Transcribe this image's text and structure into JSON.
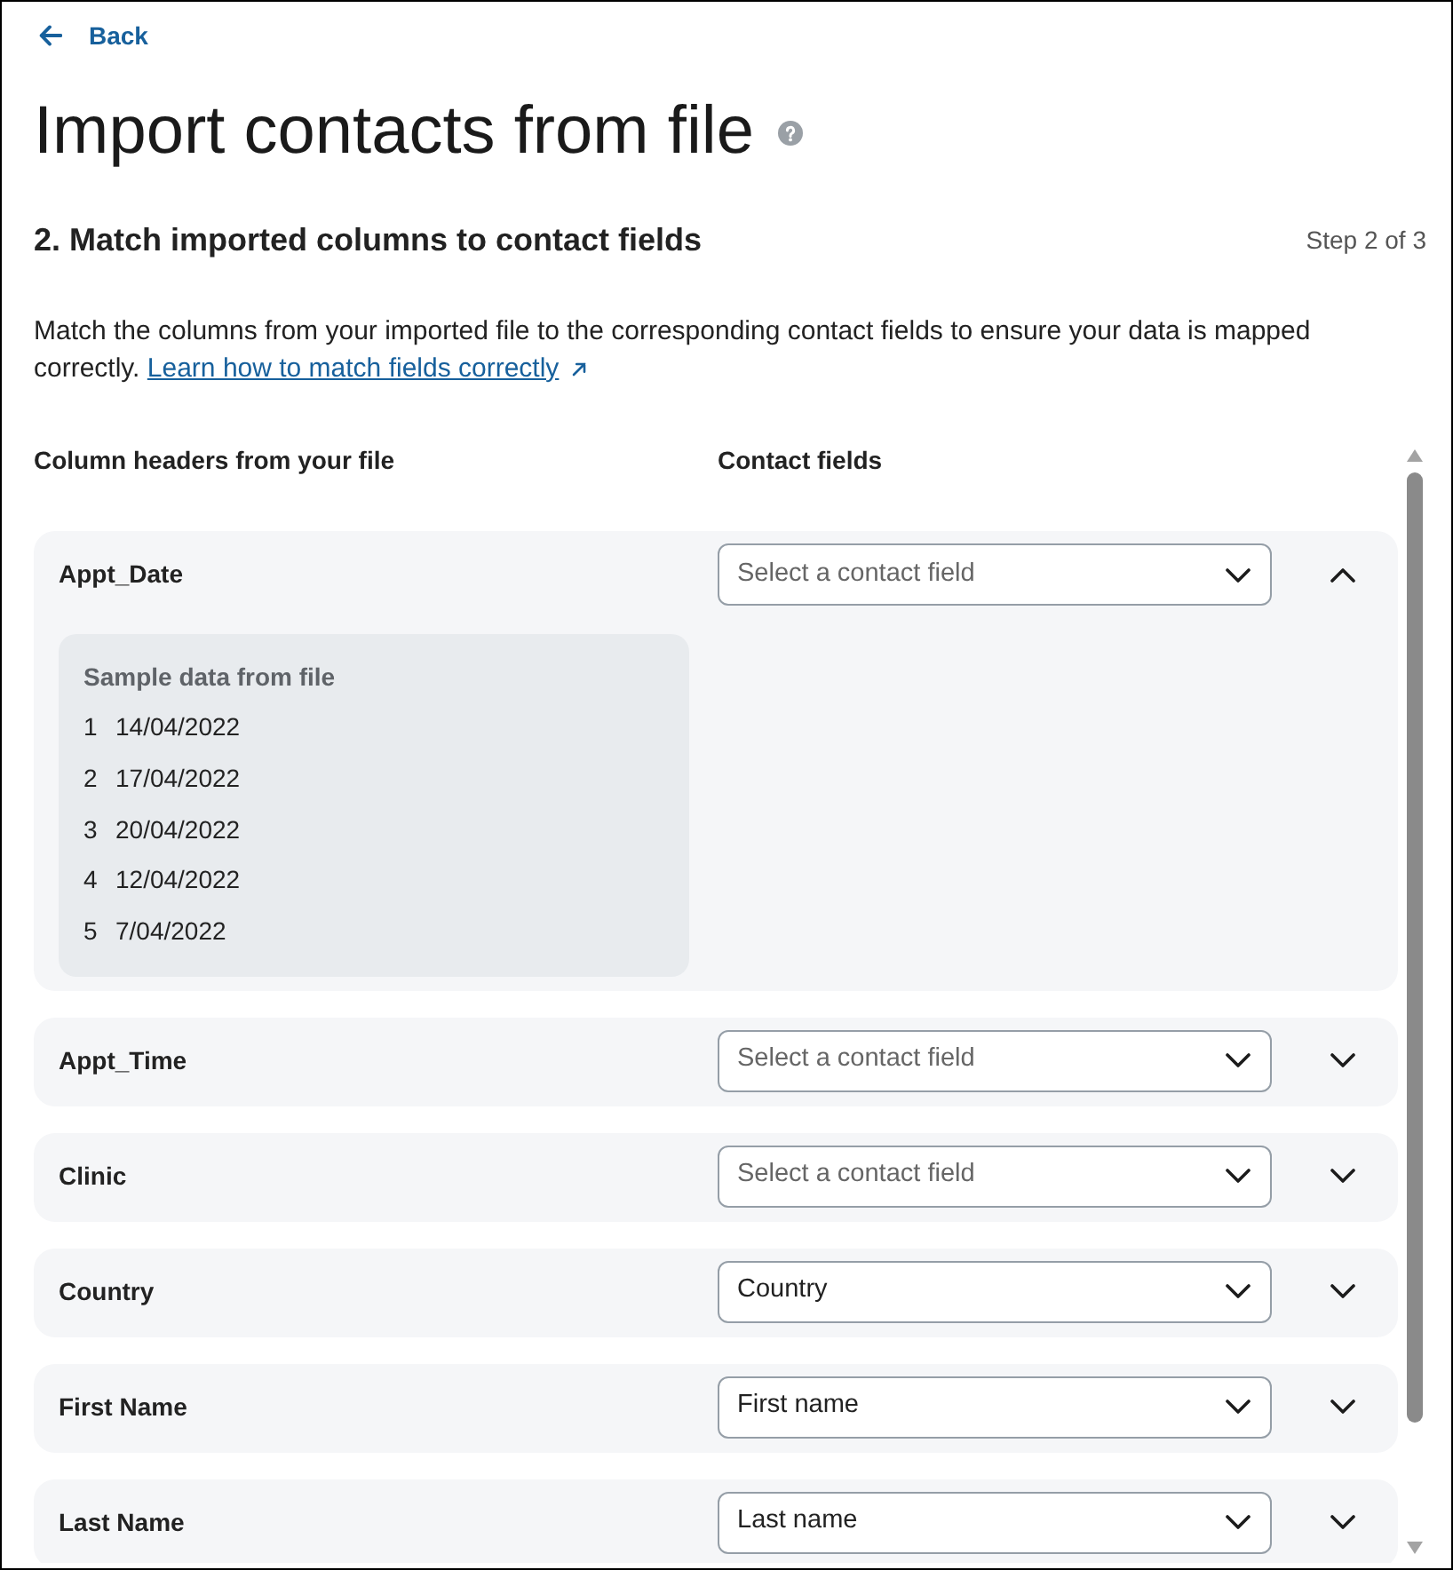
{
  "back_link": {
    "label": "Back"
  },
  "title": "Import contacts from file",
  "step": {
    "heading": "2. Match imported columns to contact fields",
    "counter": "Step 2 of 3"
  },
  "description": {
    "text": "Match the columns from your imported file to the corresponding contact fields to ensure your data is mapped correctly.",
    "link": "Learn how to match fields correctly"
  },
  "columns": [
    "Column headers from your file",
    "Contact fields"
  ],
  "mappings": [
    {
      "column": "Appt_Date",
      "field": {
        "placeholder": "Select a contact field"
      },
      "expanded": true,
      "sample": {
        "title": "Sample data from file",
        "rows": [
          {
            "index": "1",
            "value": "14/04/2022"
          },
          {
            "index": "2",
            "value": "17/04/2022"
          },
          {
            "index": "3",
            "value": "20/04/2022"
          },
          {
            "index": "4",
            "value": "12/04/2022"
          },
          {
            "index": "5",
            "value": "7/04/2022"
          }
        ]
      }
    },
    {
      "column": "Appt_Time",
      "field": {
        "placeholder": "Select a contact field"
      },
      "expanded": false
    },
    {
      "column": "Clinic",
      "field": {
        "placeholder": "Select a contact field"
      },
      "expanded": false
    },
    {
      "column": "Country",
      "field": {
        "value": "Country"
      },
      "expanded": false
    },
    {
      "column": "First Name",
      "field": {
        "value": "First name"
      },
      "expanded": false
    },
    {
      "column": "Last Name",
      "field": {
        "value": "Last name"
      },
      "expanded": false
    }
  ]
}
